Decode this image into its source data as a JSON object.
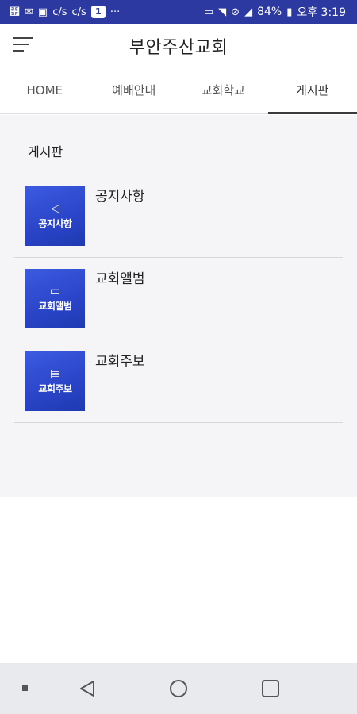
{
  "status_bar": {
    "left_icons": [
      "usb-icon",
      "mail-icon",
      "image-icon",
      "cafe-icon",
      "cafe-icon",
      "notification-count-icon",
      "more-icon"
    ],
    "cafe_label": "c/s",
    "notification_count": "1",
    "more": "···",
    "battery": "84%",
    "time": "오후 3:19"
  },
  "app_bar": {
    "title": "부안주산교회"
  },
  "tabs": [
    {
      "label": "HOME"
    },
    {
      "label": "예배안내"
    },
    {
      "label": "교회학교"
    },
    {
      "label": "게시판"
    }
  ],
  "active_tab": "게시판",
  "board": {
    "title": "게시판",
    "items": [
      {
        "label": "공지사항",
        "thumb_label": "공지사항",
        "thumb_icon": "megaphone-icon"
      },
      {
        "label": "교회앨범",
        "thumb_label": "교회앨범",
        "thumb_icon": "monitor-icon"
      },
      {
        "label": "교회주보",
        "thumb_label": "교회주보",
        "thumb_icon": "document-icon"
      }
    ]
  },
  "colors": {
    "status_bar": "#2c39a0",
    "thumb": "#2f4cd2",
    "content_bg": "#f5f5f8"
  }
}
